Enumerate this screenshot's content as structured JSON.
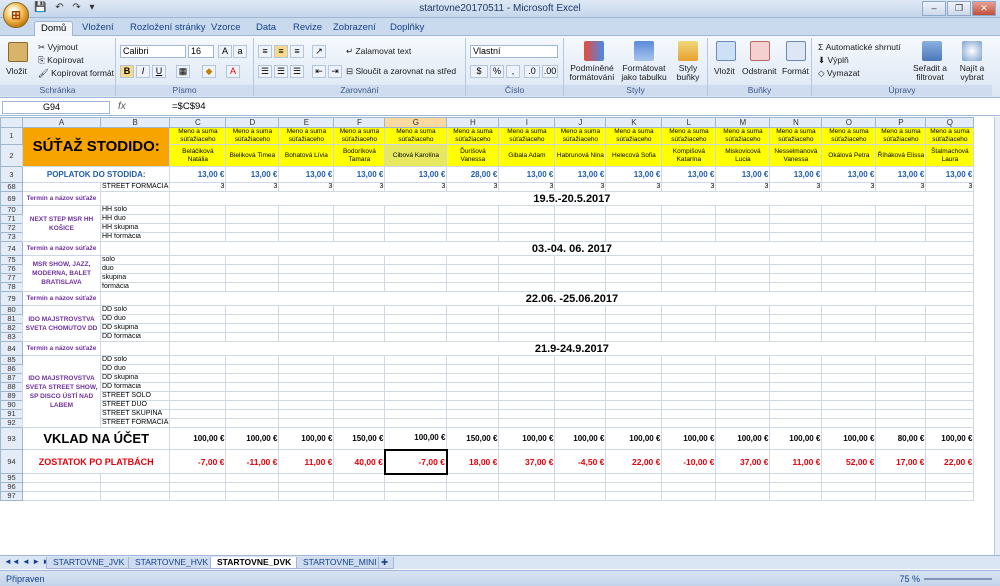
{
  "window": {
    "title": "startovne20170511 - Microsoft Excel"
  },
  "qat": "💾 ↶ ↷ ▾",
  "tabs": [
    "Domů",
    "Vložení",
    "Rozložení stránky",
    "Vzorce",
    "Data",
    "Revize",
    "Zobrazení",
    "Doplňky"
  ],
  "ribbon": {
    "clipboard": {
      "label": "Schránka",
      "paste": "Vložit",
      "cut": "Vyjmout",
      "copy": "Kopírovat",
      "format_painter": "Kopírovat formát"
    },
    "font": {
      "label": "Písmo",
      "name": "Calibri",
      "size": "16",
      "bold": "B",
      "italic": "I",
      "underline": "U"
    },
    "alignment": {
      "label": "Zarovnání",
      "wrap": "Zalamovat text",
      "merge": "Sloučit a zarovnat na střed"
    },
    "number": {
      "label": "Číslo",
      "format": "Vlastní"
    },
    "styles": {
      "label": "Styly",
      "conditional": "Podmíněné formátování",
      "as_table": "Formátovat jako tabulku",
      "cell_styles": "Styly buňky"
    },
    "cells": {
      "label": "Buňky",
      "insert": "Vložit",
      "delete": "Odstranit",
      "format": "Formát"
    },
    "editing": {
      "label": "Úpravy",
      "autosum": "Automatické shrnutí",
      "fill": "Výplň",
      "clear": "Vymazat",
      "sort": "Seřadit a filtrovat",
      "find": "Najít a vybrat"
    }
  },
  "formula_bar": {
    "name_box": "G94",
    "fx": "fx",
    "formula": "=$C$94"
  },
  "columns": [
    "A",
    "B",
    "C",
    "D",
    "E",
    "F",
    "G",
    "H",
    "I",
    "J",
    "K",
    "L",
    "M",
    "N",
    "O",
    "P",
    "Q"
  ],
  "header_rows": {
    "title": "SÚŤAŽ STODIDO:",
    "meno_label": "Meno a suma súťažiaceho",
    "names": [
      "Beláčiková Natália",
      "Bieliková Timea",
      "Bohatová Lívia",
      "Bodoríková Tamara",
      "Cibová Karolína",
      "Ďurišová Vanessa",
      "Gibala Adam",
      "Habrunová Nina",
      "Helecová Sofia",
      "Kompišová Katarína",
      "Miskovicová Lucia",
      "Nesselmanová Vanessa",
      "Okálová Petra",
      "Říháková Elissa",
      "Štalmachová Laura"
    ],
    "poplatok_label": "POPLATOK DO STODIDA:",
    "poplatok": [
      "13,00 €",
      "13,00 €",
      "13,00 €",
      "13,00 €",
      "13,00 €",
      "28,00 €",
      "13,00 €",
      "13,00 €",
      "13,00 €",
      "13,00 €",
      "13,00 €",
      "13,00 €",
      "13,00 €",
      "13,00 €",
      "13,00 €"
    ],
    "row68_label": "STREET FORMACIA",
    "row68_vals": [
      "3",
      "3",
      "3",
      "3",
      "3",
      "3",
      "3",
      "3",
      "3",
      "3",
      "3",
      "3",
      "3",
      "3",
      "3"
    ]
  },
  "sections": [
    {
      "rows": [
        "69",
        "70",
        "71",
        "72",
        "73"
      ],
      "termin": "Termín a názov súťaže",
      "date": "19.5.-20.5.2017",
      "name": "NEXT STEP MSR HH KOŠICE",
      "items": [
        "HH solo",
        "HH duo",
        "HH skupina",
        "HH formácia"
      ]
    },
    {
      "rows": [
        "74",
        "75",
        "76",
        "77",
        "78"
      ],
      "termin": "Termín a názov súťaže",
      "date": "03.-04. 06. 2017",
      "name": "MSR SHOW, JAZZ, MODERNA, BALET BRATISLAVA",
      "items": [
        "solo",
        "duo",
        "skupina",
        "formácia"
      ]
    },
    {
      "rows": [
        "79",
        "80",
        "81",
        "82",
        "83"
      ],
      "termin": "Termín a názov súťaže",
      "date": "22.06. -25.06.2017",
      "name": "IDO MAJSTROVSTVA SVETA CHOMUTOV DD",
      "items": [
        "DD solo",
        "DD duo",
        "DD skupina",
        "DD formácia"
      ]
    },
    {
      "rows": [
        "84",
        "85",
        "86",
        "87",
        "88",
        "89",
        "90",
        "91",
        "92"
      ],
      "termin": "Termín a názov súťaže",
      "date": "21.9-24.9.2017",
      "name": "IDO MAJSTROVSTVA SVETA STREET SHOW, SP DISCO ÚSTÍ NAD LABEM",
      "items": [
        "DD solo",
        "DD duo",
        "DD skupina",
        "DD formácia",
        "STREET SOLO",
        "STREET DUO",
        "STREET SKUPINA",
        "STREET FORMACIA"
      ]
    }
  ],
  "vklad": {
    "row": "93",
    "label": "VKLAD NA ÚČET",
    "vals": [
      "100,00 €",
      "100,00 €",
      "100,00 €",
      "150,00 €",
      "100,00 €",
      "150,00 €",
      "100,00 €",
      "100,00 €",
      "100,00 €",
      "100,00 €",
      "100,00 €",
      "100,00 €",
      "100,00 €",
      "80,00 €",
      "100,00 €"
    ]
  },
  "zostatok": {
    "row": "94",
    "label": "ZOSTATOK PO PLATBÁCH",
    "vals": [
      "-7,00 €",
      "-11,00 €",
      "11,00 €",
      "40,00 €",
      "-7,00 €",
      "18,00 €",
      "37,00 €",
      "-4,50 €",
      "22,00 €",
      "-10,00 €",
      "37,00 €",
      "11,00 €",
      "52,00 €",
      "17,00 €",
      "22,00 €"
    ]
  },
  "extra_rows": [
    "95",
    "96",
    "97"
  ],
  "sheet_tabs": [
    "STARTOVNE_JVK",
    "STARTOVNE_HVK",
    "STARTOVNE_DVK",
    "STARTOVNE_MINI"
  ],
  "status": {
    "ready": "Připraven",
    "zoom": "75 %"
  },
  "colors": {
    "yellow": "#ffff00",
    "orange": "#f7a300",
    "red": "#e8000a",
    "blue": "#1f5ea8",
    "purple": "#7030a0"
  }
}
